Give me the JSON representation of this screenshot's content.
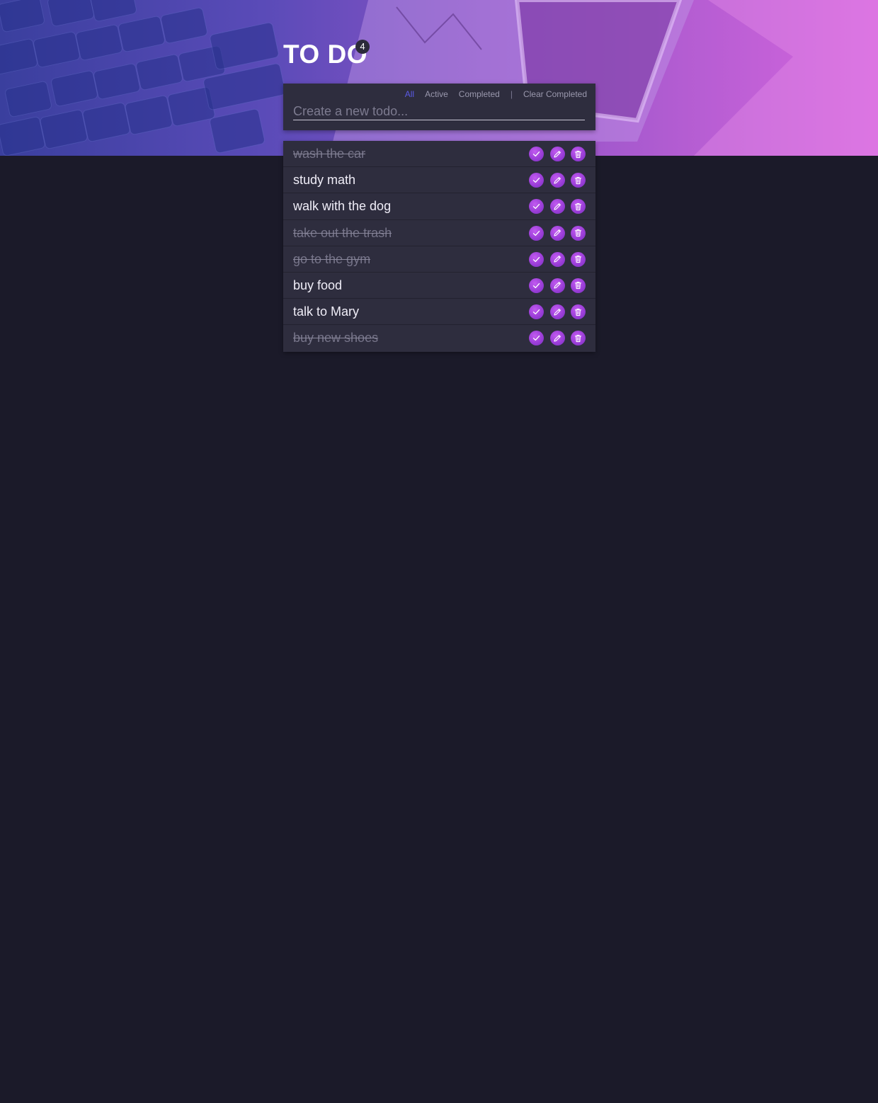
{
  "header": {
    "title": "TO DO",
    "count": "4"
  },
  "filters": {
    "all": "All",
    "active": "Active",
    "completed": "Completed",
    "separator": "|",
    "clear": "Clear Completed",
    "selected": "All"
  },
  "new_todo": {
    "placeholder": "Create a new todo...",
    "value": ""
  },
  "todos": [
    {
      "text": "wash the car",
      "completed": true
    },
    {
      "text": "study math",
      "completed": false
    },
    {
      "text": "walk with the dog",
      "completed": false
    },
    {
      "text": "take out the trash",
      "completed": true
    },
    {
      "text": "go to the gym",
      "completed": true
    },
    {
      "text": "buy food",
      "completed": false
    },
    {
      "text": "talk to Mary",
      "completed": false
    },
    {
      "text": "buy new shoes",
      "completed": true
    }
  ],
  "icons": {
    "complete": "check-icon",
    "edit": "pencil-icon",
    "delete": "trash-icon"
  },
  "colors": {
    "background": "#1b1a29",
    "panel": "#2e2d3e",
    "accent": "#9b3ed8",
    "active_filter": "#5a5ae6"
  }
}
